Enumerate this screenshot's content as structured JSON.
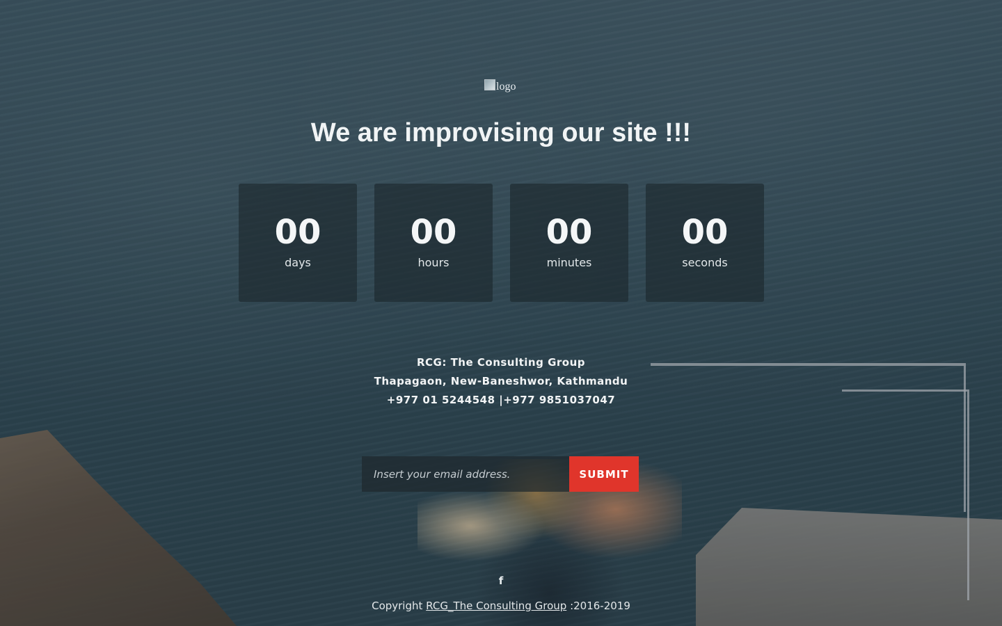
{
  "logo": {
    "alt_text": "logo"
  },
  "headline": "We are improvising our site !!!",
  "countdown": [
    {
      "value": "00",
      "unit": "days"
    },
    {
      "value": "00",
      "unit": "hours"
    },
    {
      "value": "00",
      "unit": "minutes"
    },
    {
      "value": "00",
      "unit": "seconds"
    }
  ],
  "contact": {
    "company": "RCG: The Consulting Group",
    "address": "Thapagaon, New-Baneshwor, Kathmandu",
    "phone": "+977 01 5244548 |+977 9851037047"
  },
  "subscribe": {
    "email_placeholder": "Insert your email address.",
    "email_value": "",
    "submit_label": "SUBMIT"
  },
  "social": {
    "facebook_icon": "facebook-icon",
    "facebook_glyph": "f"
  },
  "footer": {
    "prefix": "Copyright",
    "link_text": "RCG_The Consulting Group",
    "suffix": ":2016-2019"
  },
  "colors": {
    "accent": "#e0352b",
    "overlay_box": "#1c262c",
    "text": "#ffffff"
  }
}
